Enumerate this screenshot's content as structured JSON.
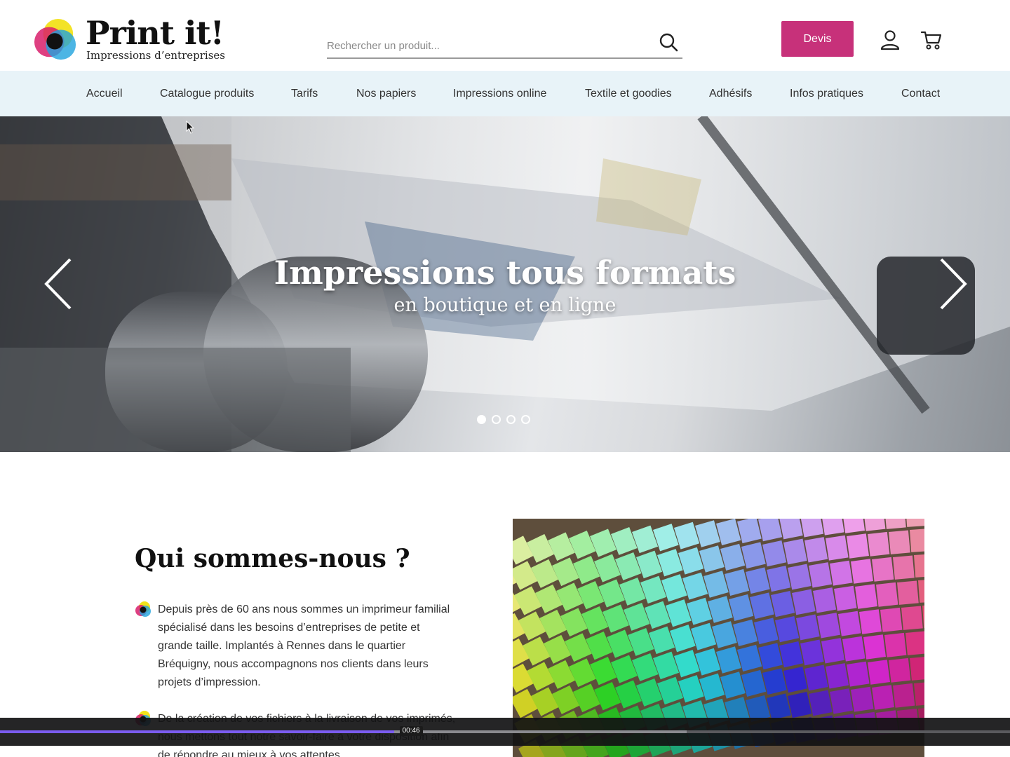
{
  "brand": {
    "name": "Print it!",
    "tagline": "Impressions d’entreprises",
    "accent_color": "#c7317a",
    "nav_background": "#e8f3f8"
  },
  "header": {
    "search_placeholder": "Rechercher un produit...",
    "search_icon": "search-icon",
    "devis_label": "Devis",
    "account_icon": "user-icon",
    "cart_icon": "cart-icon"
  },
  "nav": {
    "items": [
      {
        "label": "Accueil"
      },
      {
        "label": "Catalogue produits"
      },
      {
        "label": "Tarifs"
      },
      {
        "label": "Nos papiers"
      },
      {
        "label": "Impressions online"
      },
      {
        "label": "Textile et goodies"
      },
      {
        "label": "Adhésifs"
      },
      {
        "label": "Infos pratiques"
      },
      {
        "label": "Contact"
      }
    ]
  },
  "hero": {
    "title": "Impressions tous formats",
    "subtitle": "en boutique et en ligne",
    "prev_icon": "chevron-left-icon",
    "next_icon": "chevron-right-icon",
    "slide_count": 4,
    "active_slide": 1
  },
  "about": {
    "title": "Qui sommes-nous ?",
    "paragraphs": [
      "Depuis près de 60 ans nous sommes un imprimeur familial spécialisé dans les besoins d’entreprises de petite et grande taille. Implantés à Rennes dans le quartier Bréquigny, nous accompagnons nos clients dans leurs projets d’impression.",
      "De la création de vos fichiers à la livraison de vos imprimés, nous mettons tout notre savoir-faire à votre disposition afin de répondre au mieux à vos attentes."
    ]
  },
  "video": {
    "current_time": "00:46",
    "progress": 0.39,
    "buffered": 0.68,
    "progress_color": "#7b5cf0"
  }
}
